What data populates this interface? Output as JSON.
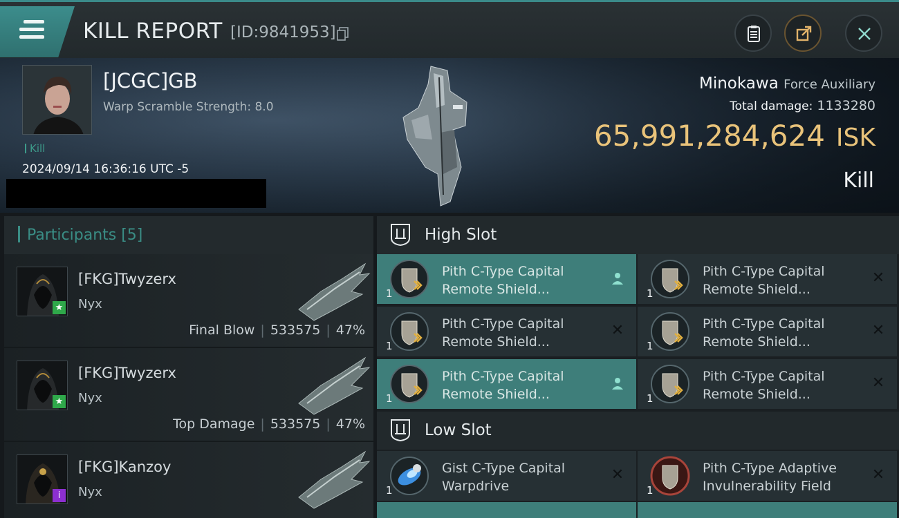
{
  "topbar": {
    "title": "KILL REPORT",
    "id_label": "[ID:9841953]",
    "menu_icon": "hamburger-icon",
    "copy_icon": "copy-icon",
    "clipboard_icon": "clipboard-icon",
    "share_icon": "share-icon",
    "close_icon": "close-icon"
  },
  "victim": {
    "name": "[JCGC]GB",
    "warp_scramble": "Warp Scramble Strength: 8.0",
    "kill_tag": "Kill",
    "timestamp": "2024/09/14 16:36:16 UTC -5",
    "ship_name": "Minokawa",
    "ship_class": "Force Auxiliary",
    "total_damage_label": "Total damage:",
    "total_damage_value": "1133280",
    "isk_value": "65,991,284,624",
    "isk_unit": "ISK",
    "result": "Kill"
  },
  "participants": {
    "header": "Participants [5]",
    "rows": [
      {
        "name": "[FKG]Twyzerx",
        "ship": "Nyx",
        "role": "Final Blow",
        "damage": "533575",
        "percent": "47%",
        "badge": "star"
      },
      {
        "name": "[FKG]Twyzerx",
        "ship": "Nyx",
        "role": "Top Damage",
        "damage": "533575",
        "percent": "47%",
        "badge": "star"
      },
      {
        "name": "[FKG]Kanzoy",
        "ship": "Nyx",
        "role": "",
        "damage": "",
        "percent": "",
        "badge": "info"
      }
    ]
  },
  "fitting": {
    "high_slot": {
      "title": "High Slot",
      "modules": [
        {
          "name_line1": "Pith C-Type Capital",
          "name_line2": "Remote Shield...",
          "qty": "1",
          "state": "active"
        },
        {
          "name_line1": "Pith C-Type Capital",
          "name_line2": "Remote Shield...",
          "qty": "1",
          "state": "destroyed"
        },
        {
          "name_line1": "Pith C-Type Capital",
          "name_line2": "Remote Shield...",
          "qty": "1",
          "state": "destroyed"
        },
        {
          "name_line1": "Pith C-Type Capital",
          "name_line2": "Remote Shield...",
          "qty": "1",
          "state": "destroyed"
        },
        {
          "name_line1": "Pith C-Type Capital",
          "name_line2": "Remote Shield...",
          "qty": "1",
          "state": "active"
        },
        {
          "name_line1": "Pith C-Type Capital",
          "name_line2": "Remote Shield...",
          "qty": "1",
          "state": "destroyed"
        }
      ]
    },
    "low_slot": {
      "title": "Low Slot",
      "modules": [
        {
          "name_line1": "Gist C-Type Capital",
          "name_line2": "Warpdrive",
          "qty": "1",
          "state": "destroyed"
        },
        {
          "name_line1": "Pith C-Type Adaptive",
          "name_line2": "Invulnerability Field",
          "qty": "1",
          "state": "destroyed"
        }
      ]
    }
  },
  "colors": {
    "accent": "#3e7e7a",
    "isk": "#e9c37a",
    "participants_header": "#3a8d85"
  }
}
